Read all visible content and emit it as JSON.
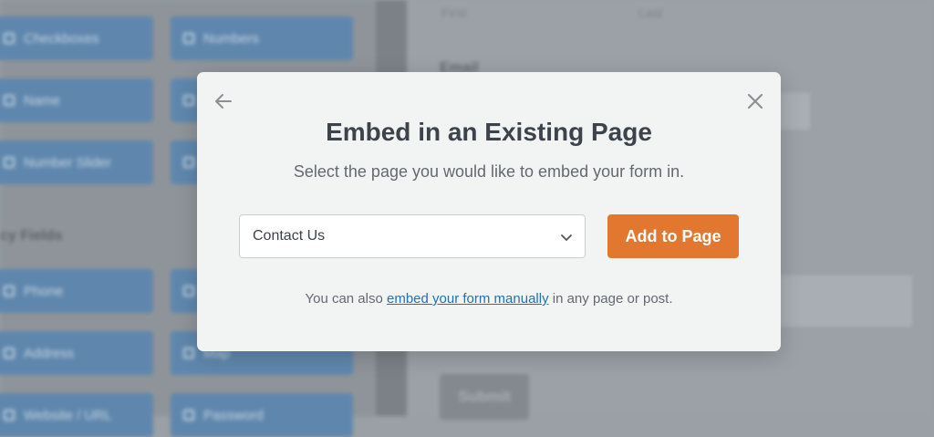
{
  "background": {
    "fields": [
      {
        "label": "Checkboxes",
        "icon": "checkbox-icon"
      },
      {
        "label": "Numbers",
        "icon": "hash-icon"
      },
      {
        "label": "Name",
        "icon": "user-icon"
      },
      {
        "label": "",
        "icon": "field-icon"
      },
      {
        "label": "Number Slider",
        "icon": "slider-icon"
      },
      {
        "label": "",
        "icon": "field-icon"
      }
    ],
    "fancy_section_title": "cy Fields",
    "fancy_fields": [
      {
        "label": "Phone",
        "icon": "phone-icon"
      },
      {
        "label": "",
        "icon": "field-icon"
      },
      {
        "label": "Address",
        "icon": "map-pin-icon"
      },
      {
        "label": "Map",
        "icon": "map-icon"
      },
      {
        "label": "Website / URL",
        "icon": "link-icon"
      },
      {
        "label": "Password",
        "icon": "lock-icon"
      }
    ],
    "preview": {
      "first_label": "First",
      "last_label": "Last",
      "email_heading": "Email",
      "submit_label": "Submit"
    }
  },
  "modal": {
    "back_icon": "arrow-left-icon",
    "close_icon": "close-icon",
    "title": "Embed in an Existing Page",
    "subtitle": "Select the page you would like to embed your form in.",
    "select": {
      "value": "Contact Us",
      "icon": "chevron-down-icon"
    },
    "add_button": "Add to Page",
    "footnote": {
      "prefix": "You can also ",
      "link": "embed your form manually",
      "suffix": " in any page or post."
    }
  },
  "colors": {
    "accent": "#e27730",
    "link": "#2271b1",
    "title": "#3c434a",
    "modal_bg": "#f2f4f4"
  }
}
